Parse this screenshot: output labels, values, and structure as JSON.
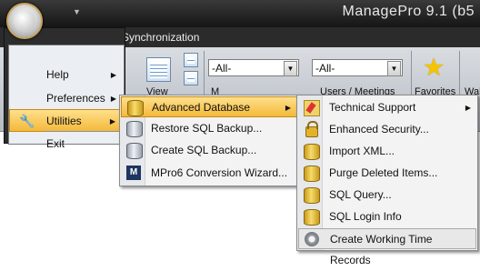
{
  "window": {
    "title": "ManagePro 9.1 (b5"
  },
  "ribbon": {
    "tab_label": "Synchronization",
    "view_label": "View",
    "combo1_value": "-All-",
    "combo2_value": "-All-",
    "favorites_label": "Favorites",
    "cut_label": "Wal",
    "partial_label1": "M",
    "partial_label2": "Users / Meetings"
  },
  "app_menu": {
    "items": [
      {
        "label": "Help",
        "has_submenu": true
      },
      {
        "label": "Preferences",
        "has_submenu": true
      },
      {
        "label": "Utilities",
        "has_submenu": true,
        "highlighted": true
      },
      {
        "label": "Exit",
        "has_submenu": false
      }
    ]
  },
  "utilities_menu": {
    "items": [
      {
        "label": "Advanced Database",
        "has_submenu": true,
        "highlighted": true,
        "icon": "database-icon"
      },
      {
        "label": "Restore SQL Backup...",
        "icon": "database-restore-icon"
      },
      {
        "label": "Create SQL Backup...",
        "icon": "database-backup-icon"
      },
      {
        "label": "MPro6 Conversion Wizard...",
        "icon": "mpro-icon"
      }
    ]
  },
  "advanced_db_menu": {
    "items": [
      {
        "label": "Technical Support",
        "has_submenu": true,
        "icon": "tools-icon"
      },
      {
        "label": "Enhanced Security...",
        "icon": "lock-icon"
      },
      {
        "label": "Import XML...",
        "icon": "database-import-icon"
      },
      {
        "label": "Purge Deleted Items...",
        "icon": "database-purge-icon"
      },
      {
        "label": "SQL Query...",
        "icon": "database-query-icon"
      },
      {
        "label": "SQL Login Info",
        "icon": "database-login-icon"
      },
      {
        "label": "Create Working Time Records",
        "icon": "gear-icon",
        "hovered": true
      }
    ]
  },
  "colors": {
    "highlight": "#f4b93a",
    "titlebar": "#1e1e1e",
    "menu_bg": "#f3f3f3"
  }
}
